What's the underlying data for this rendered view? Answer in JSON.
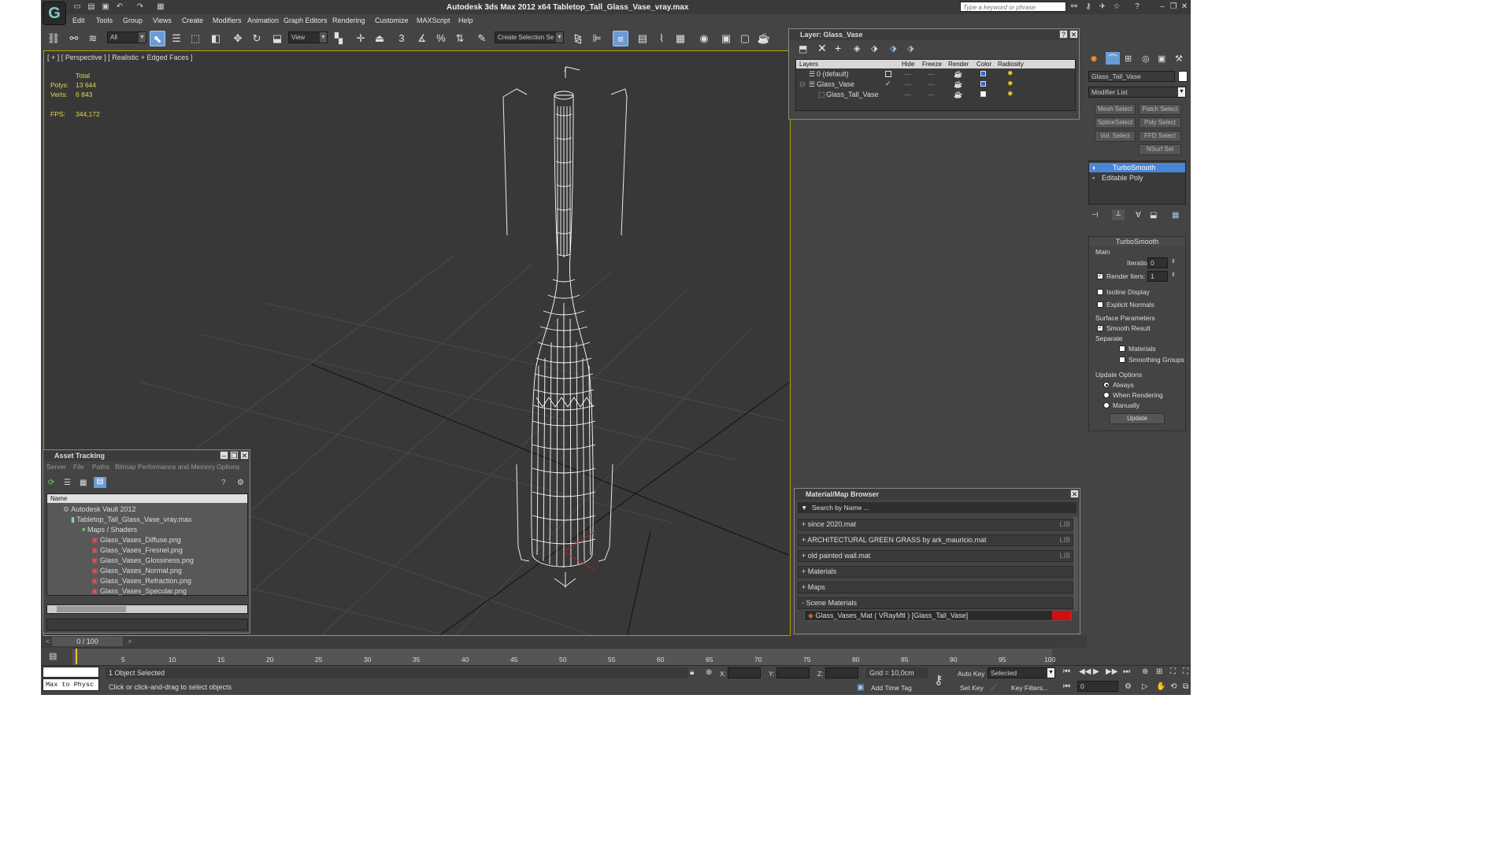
{
  "app": {
    "title": "Autodesk 3ds Max  2012 x64      Tabletop_Tall_Glass_Vase_vray.max",
    "search_placeholder": "Type a keyword or phrase"
  },
  "menu": [
    "Edit",
    "Tools",
    "Group",
    "Views",
    "Create",
    "Modifiers",
    "Animation",
    "Graph Editors",
    "Rendering",
    "Customize",
    "MAXScript",
    "Help"
  ],
  "toolbar": {
    "filter": "All",
    "ref_coord": "View",
    "selection_set": "Create Selection Se",
    "snap_3": "3",
    "snap_pct": "%"
  },
  "viewport": {
    "label": "[ + ] [ Perspective ] [ Realistic + Edged Faces ]",
    "stats": {
      "total": "Total",
      "polys_label": "Polys:",
      "polys": "13 644",
      "verts_label": "Verts:",
      "verts": "6 843",
      "fps_label": "FPS:",
      "fps": "344,172"
    }
  },
  "layer_panel": {
    "title": "Layer: Glass_Vase",
    "columns": [
      "Layers",
      "",
      "Hide",
      "Freeze",
      "Render",
      "Color",
      "Radiosity"
    ],
    "rows": [
      "0 (default)",
      "Glass_Vase",
      "Glass_Tall_Vase"
    ]
  },
  "asset_tracking": {
    "title": "Asset Tracking",
    "menu": [
      "Server",
      "File",
      "Paths",
      "Bitmap Performance and Memory",
      "Options"
    ],
    "column": "Name",
    "items": [
      "Autodesk Vault 2012",
      "Tabletop_Tall_Glass_Vase_vray.max",
      "Maps / Shaders",
      "Glass_Vases_Diffuse.png",
      "Glass_Vases_Fresnel.png",
      "Glass_Vases_Glossiness.png",
      "Glass_Vases_Normal.png",
      "Glass_Vases_Refraction.png",
      "Glass_Vases_Specular.png"
    ]
  },
  "material_browser": {
    "title": "Material/Map Browser",
    "search": "Search by Name ...",
    "groups": [
      "+ since 2020.mat",
      "+ ARCHITECTURAL GREEN GRASS by ark_mauricio.mat",
      "+ old painted wall.mat",
      "+ Materials",
      "+ Maps",
      "- Scene Materials"
    ],
    "lib_tag": "LIB",
    "scene_material": "Glass_Vases_Mat  ( VRayMtl )  [Glass_Tall_Vase]"
  },
  "command_panel": {
    "object_name": "Glass_Tall_Vase",
    "modifier_list": "Modifier List",
    "buttons": [
      "Mesh Select",
      "Patch Select",
      "SplineSelect",
      "Poly Select",
      "Vol. Select",
      "FFD Select",
      "NSurf Sel"
    ],
    "stack": [
      "TurboSmooth",
      "Editable Poly"
    ],
    "rollout_title": "TurboSmooth",
    "main_label": "Main",
    "iterations_label": "Iterations:",
    "iterations": "0",
    "render_iters_label": "Render Iters:",
    "render_iters": "1",
    "isoline": "Isoline Display",
    "explicit_normals": "Explicit Normals",
    "surface_params": "Surface Parameters",
    "smooth_result": "Smooth Result",
    "separate": "Separate",
    "materials": "Materials",
    "smoothing_groups": "Smoothing Groups",
    "update_options": "Update Options",
    "always": "Always",
    "when_rendering": "When Rendering",
    "manually": "Manually",
    "update_btn": "Update"
  },
  "timeline": {
    "position": "0 / 100",
    "ticks": [
      "5",
      "10",
      "15",
      "20",
      "25",
      "30",
      "35",
      "40",
      "45",
      "50",
      "55",
      "60",
      "65",
      "70",
      "75",
      "80",
      "85",
      "90",
      "95",
      "100"
    ]
  },
  "status": {
    "maxscript": "Max to Physc",
    "selected": "1 Object Selected",
    "prompt": "Click or click-and-drag to select objects",
    "x_label": "X:",
    "y_label": "Y:",
    "z_label": "Z:",
    "grid": "Grid = 10,0cm",
    "add_time_tag": "Add Time Tag",
    "auto_key": "Auto Key",
    "set_key": "Set Key",
    "selected_dropdown": "Selected",
    "key_filters": "Key Filters...",
    "frame": "0"
  }
}
